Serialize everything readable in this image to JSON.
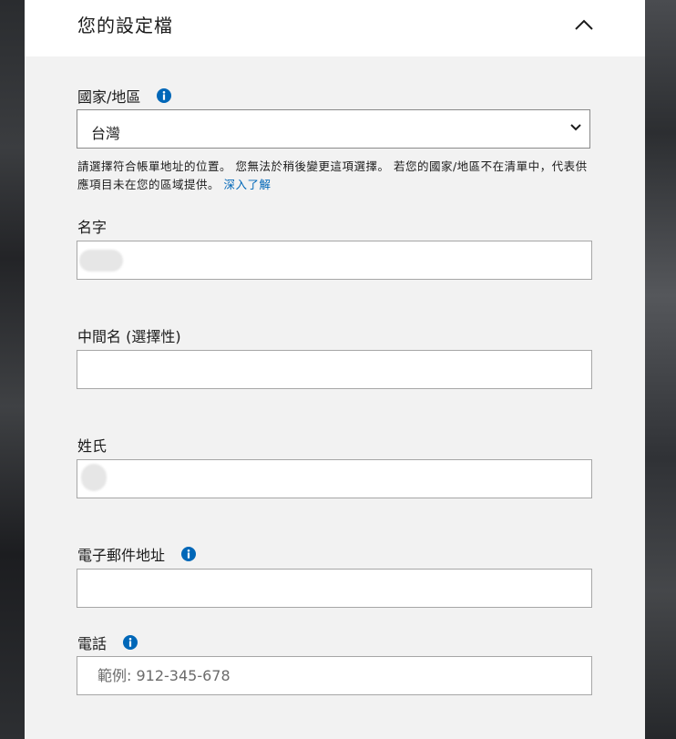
{
  "panel": {
    "title": "您的設定檔",
    "collapse_icon": "chevron-up-icon"
  },
  "country": {
    "label": "國家/地區",
    "info_icon": "info-icon",
    "selected": "台灣",
    "help_text": "請選擇符合帳單地址的位置。 您無法於稍後變更這項選擇。 若您的國家/地區不在清單中，代表供應項目未在您的區域提供。 ",
    "help_link": "深入了解"
  },
  "first_name": {
    "label": "名字",
    "value": ""
  },
  "middle_name": {
    "label": "中間名 (選擇性)",
    "value": ""
  },
  "last_name": {
    "label": "姓氏",
    "value": ""
  },
  "email": {
    "label": "電子郵件地址",
    "info_icon": "info-icon",
    "value": ""
  },
  "phone": {
    "label": "電話",
    "info_icon": "info-icon",
    "placeholder": "範例: 912-345-678"
  },
  "colors": {
    "accent": "#0067b8",
    "panel_bg": "#f2f2f2",
    "header_bg": "#ffffff"
  }
}
